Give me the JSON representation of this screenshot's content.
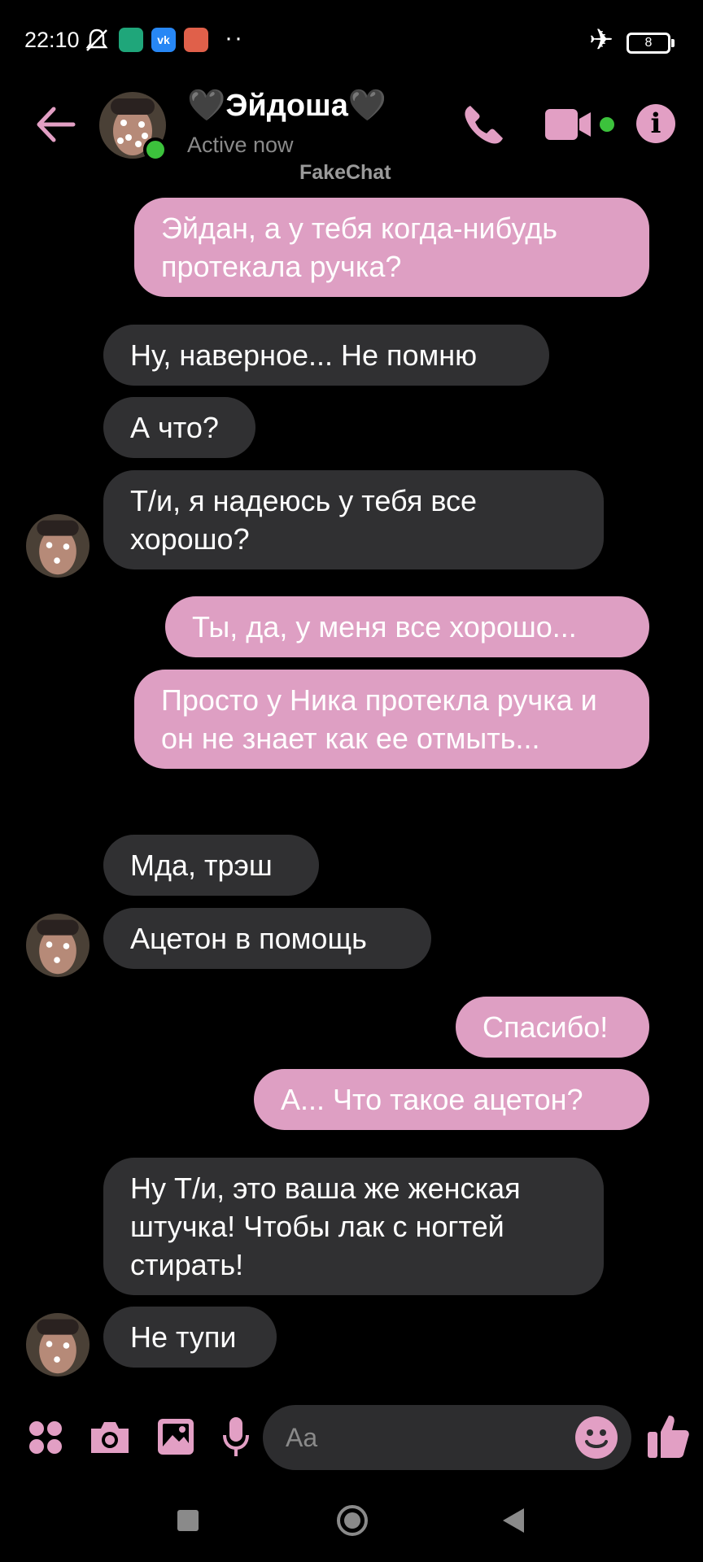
{
  "status_bar": {
    "time": "22:10",
    "more": "··",
    "battery": "8"
  },
  "header": {
    "contact_name": "🖤Эйдоша🖤",
    "status": "Active now",
    "watermark": "FakeChat"
  },
  "messages": [
    {
      "side": "out",
      "text": "Эйдан, а у тебя когда-нибудь протекала ручка?"
    },
    {
      "side": "in",
      "text": "Ну, наверное... Не помню"
    },
    {
      "side": "in",
      "text": "А что?"
    },
    {
      "side": "in",
      "text": "Т/и, я надеюсь у тебя все хорошо?"
    },
    {
      "side": "out",
      "text": "Ты, да, у меня все хорошо..."
    },
    {
      "side": "out",
      "text": "Просто у Ника протекла ручка и он не знает как ее отмыть..."
    },
    {
      "side": "in",
      "text": "Мда, трэш"
    },
    {
      "side": "in",
      "text": "Ацетон в помощь"
    },
    {
      "side": "out",
      "text": "Спасибо!"
    },
    {
      "side": "out",
      "text": "А... Что такое ацетон?"
    },
    {
      "side": "in",
      "text": "Ну Т/и, это ваша же женская штучка! Чтобы лак с ногтей стирать!"
    },
    {
      "side": "in",
      "text": "Не тупи"
    }
  ],
  "composer": {
    "placeholder": "Aa"
  },
  "colors": {
    "accent": "#e29fc4",
    "outgoing_bubble": "#de9fc3",
    "incoming_bubble": "#303032",
    "online": "#3cc23c"
  },
  "icons": [
    "bell-off-icon",
    "shield-app-icon",
    "vk-app-icon",
    "app-icon",
    "airplane-icon",
    "battery-icon",
    "back-arrow-icon",
    "phone-icon",
    "video-icon",
    "info-icon",
    "apps-grid-icon",
    "camera-icon",
    "gallery-icon",
    "mic-icon",
    "emoji-icon",
    "thumbs-up-icon",
    "nav-recents-icon",
    "nav-home-icon",
    "nav-back-icon"
  ]
}
